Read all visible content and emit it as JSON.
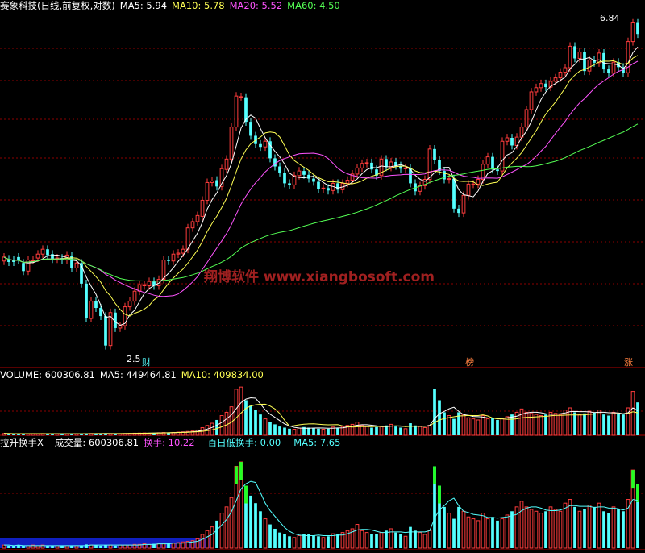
{
  "colors": {
    "up": "#ff3c3c",
    "down": "#54ffff",
    "ma5": "#ffffff",
    "ma10": "#ffff54",
    "ma20": "#ff54ff",
    "ma60": "#54ff54",
    "volume_ma10": "#ffff54",
    "cyan_text": "#54ffff",
    "watermark": "#a02020",
    "mask_blue": "#1020c0"
  },
  "main_panel": {
    "title": "赛象科技(日线,前复权,对数)",
    "ma5_label": "MA5: 5.94",
    "ma10_label": "MA10: 5.78",
    "ma20_label": "MA20: 5.52",
    "ma60_label": "MA60: 4.50",
    "high_label": "6.84",
    "low_label": "2.5",
    "marker_cai": "财",
    "marker_bang": "榜",
    "marker_zhang": "涨",
    "watermark": "翔博软件  www.xiangbosoft.com"
  },
  "volume_panel": {
    "title": "VOLUME: 600306.81",
    "ma5_label": "MA5: 449464.81",
    "ma10_label": "MA10: 409834.00"
  },
  "indicator_panel": {
    "title": "拉升换手X",
    "volume_label": "成交量: 600306.81",
    "turnover_label": "换手: 10.22",
    "low_turnover_label": "百日低换手: 0.00",
    "ma5_label": "MA5: 7.65"
  },
  "chart_data": {
    "type": "candlestick",
    "y_scale": "log",
    "price_ylim": [
      2.5,
      6.9
    ],
    "volume_ylim": [
      0,
      1000000
    ],
    "turnover_ylim": [
      0,
      16
    ],
    "min_low": 2.5,
    "max_high": 6.84,
    "bars": 132,
    "o": [
      3.32,
      3.34,
      3.33,
      3.36,
      3.3,
      3.22,
      3.33,
      3.35,
      3.39,
      3.44,
      3.39,
      3.34,
      3.35,
      3.33,
      3.37,
      3.25,
      3.3,
      3.1,
      2.79,
      2.94,
      2.88,
      2.81,
      2.57,
      2.84,
      2.71,
      2.73,
      2.89,
      2.94,
      3.03,
      3.08,
      3.08,
      3.12,
      3.08,
      3.14,
      3.33,
      3.32,
      3.39,
      3.4,
      3.44,
      3.67,
      3.74,
      3.8,
      3.99,
      4.21,
      4.24,
      4.16,
      4.38,
      4.52,
      4.98,
      5.46,
      5.45,
      5.06,
      4.85,
      4.73,
      4.69,
      4.77,
      4.53,
      4.42,
      4.34,
      4.2,
      4.18,
      4.3,
      4.36,
      4.31,
      4.26,
      4.22,
      4.13,
      4.14,
      4.11,
      4.2,
      4.12,
      4.2,
      4.24,
      4.32,
      4.4,
      4.46,
      4.47,
      4.38,
      4.3,
      4.52,
      4.41,
      4.48,
      4.43,
      4.39,
      4.4,
      4.2,
      4.1,
      4.17,
      4.25,
      4.66,
      4.51,
      4.36,
      4.25,
      4.26,
      3.89,
      3.84,
      4.05,
      4.19,
      4.19,
      4.25,
      4.45,
      4.55,
      4.38,
      4.36,
      4.77,
      4.82,
      4.71,
      4.83,
      4.98,
      5.25,
      5.54,
      5.61,
      5.68,
      5.62,
      5.72,
      5.78,
      5.88,
      5.96,
      6.36,
      6.13,
      6.25,
      5.9,
      6.1,
      6.05,
      6.23,
      5.93,
      5.86,
      6.06,
      5.97,
      5.87,
      6.45,
      6.84
    ],
    "c": [
      3.36,
      3.31,
      3.31,
      3.33,
      3.22,
      3.33,
      3.33,
      3.39,
      3.44,
      3.38,
      3.34,
      3.35,
      3.33,
      3.38,
      3.25,
      3.3,
      3.1,
      2.79,
      2.94,
      2.88,
      2.81,
      2.57,
      2.84,
      2.71,
      2.73,
      2.89,
      2.94,
      3.03,
      3.09,
      3.09,
      3.12,
      3.08,
      3.14,
      3.33,
      3.32,
      3.39,
      3.4,
      3.44,
      3.67,
      3.74,
      3.81,
      3.99,
      4.21,
      4.23,
      4.16,
      4.39,
      4.52,
      4.98,
      5.47,
      5.46,
      5.06,
      4.85,
      4.73,
      4.69,
      4.77,
      4.53,
      4.42,
      4.34,
      4.2,
      4.18,
      4.3,
      4.36,
      4.31,
      4.26,
      4.22,
      4.13,
      4.14,
      4.11,
      4.2,
      4.12,
      4.2,
      4.24,
      4.32,
      4.4,
      4.46,
      4.47,
      4.38,
      4.3,
      4.52,
      4.41,
      4.48,
      4.43,
      4.39,
      4.4,
      4.2,
      4.1,
      4.17,
      4.25,
      4.66,
      4.51,
      4.36,
      4.25,
      4.26,
      3.89,
      3.84,
      4.05,
      4.19,
      4.19,
      4.25,
      4.45,
      4.55,
      4.38,
      4.36,
      4.77,
      4.82,
      4.71,
      4.83,
      4.98,
      5.25,
      5.54,
      5.61,
      5.68,
      5.62,
      5.72,
      5.78,
      5.88,
      5.96,
      6.36,
      6.13,
      6.25,
      5.9,
      6.1,
      6.05,
      6.23,
      5.93,
      5.86,
      6.06,
      5.97,
      5.87,
      6.45,
      6.84,
      6.6
    ],
    "volume": [
      32000,
      30000,
      28000,
      30000,
      26000,
      28000,
      30000,
      29000,
      31000,
      27000,
      25000,
      28000,
      26000,
      27000,
      24000,
      26000,
      28000,
      36000,
      32000,
      30000,
      28000,
      34000,
      30000,
      28000,
      30000,
      32000,
      34000,
      38000,
      40000,
      42000,
      38000,
      44000,
      46000,
      50000,
      48000,
      52000,
      58000,
      62000,
      70000,
      78000,
      96000,
      140000,
      180000,
      220000,
      280000,
      360000,
      420000,
      520000,
      840000,
      880000,
      640000,
      540000,
      460000,
      380000,
      300000,
      240000,
      200000,
      160000,
      140000,
      120000,
      110000,
      130000,
      150000,
      140000,
      130000,
      120000,
      110000,
      120000,
      150000,
      140000,
      160000,
      180000,
      200000,
      240000,
      180000,
      160000,
      140000,
      150000,
      160000,
      180000,
      200000,
      160000,
      140000,
      120000,
      220000,
      180000,
      160000,
      140000,
      180000,
      840000,
      640000,
      420000,
      360000,
      300000,
      420000,
      380000,
      320000,
      300000,
      280000,
      360000,
      300000,
      320000,
      280000,
      300000,
      340000,
      380000,
      420000,
      480000,
      420000,
      400000,
      380000,
      360000,
      380000,
      420000,
      400000,
      380000,
      460000,
      500000,
      420000,
      380000,
      400000,
      440000,
      420000,
      460000,
      380000,
      360000,
      420000,
      400000,
      380000,
      500000,
      800000,
      600306.81
    ],
    "volume_ma5": [
      32000,
      31000,
      30000,
      30000,
      29200,
      28400,
      28400,
      28600,
      28800,
      29000,
      28400,
      28000,
      27400,
      26600,
      26000,
      26200,
      26200,
      28200,
      29200,
      30400,
      30800,
      32000,
      31200,
      30400,
      30000,
      30800,
      30800,
      32400,
      34800,
      37200,
      38400,
      39600,
      42000,
      44000,
      45200,
      48000,
      50800,
      54000,
      58000,
      64000,
      72800,
      89200,
      112800,
      142800,
      183200,
      236000,
      300000,
      372000,
      484000,
      596000,
      660000,
      684000,
      676000,
      572000,
      464000,
      384000,
      328000,
      268000,
      208000,
      172000,
      146000,
      132000,
      130000,
      130000,
      132000,
      134000,
      132000,
      128000,
      130000,
      134000,
      136000,
      150000,
      166000,
      184000,
      192000,
      192000,
      184000,
      174000,
      158000,
      158000,
      166000,
      170000,
      166000,
      160000,
      168000,
      164000,
      164000,
      164000,
      180000,
      304000,
      392000,
      436000,
      484000,
      512000,
      436000,
      376000,
      364000,
      344000,
      340000,
      332000,
      316000,
      316000,
      304000,
      312000,
      320000,
      332000,
      348000,
      384000,
      408000,
      420000,
      420000,
      412000,
      392000,
      384000,
      388000,
      392000,
      408000,
      432000,
      436000,
      432000,
      432000,
      428000,
      416000,
      420000,
      420000,
      412000,
      412000,
      408000,
      392000,
      412000,
      500000,
      449464.81
    ],
    "volume_ma10": [
      32000,
      31000,
      30000,
      30000,
      29200,
      29200,
      29400,
      29400,
      29800,
      29400,
      28700,
      28500,
      28300,
      28000,
      27700,
      27500,
      27300,
      28100,
      28200,
      28800,
      29200,
      30000,
      30000,
      30100,
      30700,
      31300,
      32100,
      33700,
      35500,
      37300,
      38300,
      39300,
      40900,
      43100,
      44900,
      47100,
      49500,
      52300,
      55700,
      59700,
      64500,
      72700,
      84900,
      100300,
      123500,
      154500,
      191500,
      236500,
      318500,
      405500,
      491500,
      535500,
      557500,
      565500,
      567500,
      534500,
      481500,
      398500,
      273500,
      165500,
      176300,
      191300,
      201300,
      207300,
      208500,
      201700,
      195700,
      191500,
      192500,
      193500,
      172500,
      158500,
      151500,
      155500,
      158500,
      159500,
      159500,
      162500,
      162500,
      164500,
      168500,
      173500,
      170500,
      158000,
      163000,
      165000,
      167000,
      166000,
      170000,
      235500,
      279500,
      305500,
      323500,
      337500,
      353500,
      357500,
      361500,
      361000,
      361000,
      373000,
      353500,
      315000,
      300000,
      300000,
      293000,
      293000,
      301000,
      317000,
      327000,
      331000,
      337000,
      341000,
      345000,
      357000,
      363000,
      364000,
      368000,
      372000,
      372000,
      370000,
      374000,
      382000,
      388000,
      392000,
      390000,
      388000,
      392000,
      393000,
      389000,
      397000,
      430000,
      409834.0
    ],
    "turnover": [
      0.5,
      0.4,
      0.4,
      0.5,
      0.4,
      0.4,
      0.5,
      0.4,
      0.5,
      0.4,
      0.4,
      0.4,
      0.4,
      0.4,
      0.4,
      0.4,
      0.4,
      0.6,
      0.5,
      0.5,
      0.4,
      0.5,
      0.5,
      0.4,
      0.5,
      0.5,
      0.5,
      0.6,
      0.6,
      0.7,
      0.6,
      0.7,
      0.7,
      0.8,
      0.8,
      0.8,
      0.9,
      1.0,
      1.1,
      1.2,
      1.5,
      2.2,
      2.8,
      3.4,
      4.4,
      5.6,
      6.6,
      8.1,
      13.1,
      13.8,
      10.0,
      8.4,
      7.2,
      5.9,
      4.7,
      3.8,
      3.1,
      2.5,
      2.2,
      1.9,
      1.7,
      2.0,
      2.3,
      2.2,
      2.0,
      1.9,
      1.7,
      1.9,
      2.3,
      2.2,
      2.5,
      2.8,
      3.1,
      3.8,
      2.8,
      2.5,
      2.2,
      2.3,
      2.5,
      2.8,
      3.1,
      2.5,
      2.2,
      1.9,
      3.4,
      2.8,
      2.5,
      2.2,
      2.8,
      13.1,
      10.0,
      6.6,
      5.6,
      4.7,
      6.6,
      5.9,
      5.0,
      4.7,
      4.4,
      5.6,
      4.7,
      5.0,
      4.4,
      4.7,
      5.3,
      5.9,
      6.6,
      7.5,
      6.6,
      6.2,
      5.9,
      5.6,
      5.9,
      6.6,
      6.2,
      5.9,
      7.2,
      7.8,
      6.6,
      5.9,
      6.2,
      6.9,
      6.6,
      7.2,
      5.9,
      5.6,
      6.6,
      6.2,
      5.9,
      7.8,
      12.5,
      10.22
    ],
    "turnover_ma5": [
      0.5,
      0.5,
      0.4,
      0.5,
      0.4,
      0.4,
      0.4,
      0.4,
      0.4,
      0.4,
      0.4,
      0.4,
      0.4,
      0.4,
      0.4,
      0.4,
      0.4,
      0.4,
      0.5,
      0.5,
      0.5,
      0.5,
      0.5,
      0.5,
      0.5,
      0.5,
      0.5,
      0.5,
      0.5,
      0.6,
      0.6,
      0.6,
      0.7,
      0.7,
      0.7,
      0.8,
      0.8,
      0.8,
      0.9,
      1.0,
      1.1,
      1.4,
      1.8,
      2.2,
      2.9,
      3.7,
      4.6,
      5.8,
      7.6,
      9.5,
      10.3,
      10.7,
      10.5,
      8.9,
      7.2,
      6.0,
      5.1,
      4.2,
      3.3,
      2.7,
      2.3,
      2.1,
      2.0,
      2.0,
      2.0,
      2.1,
      2.0,
      2.0,
      2.0,
      2.1,
      2.1,
      2.3,
      2.6,
      2.9,
      3.0,
      3.0,
      2.9,
      2.7,
      2.5,
      2.5,
      2.6,
      2.6,
      2.6,
      2.5,
      2.6,
      2.6,
      2.6,
      2.6,
      2.8,
      4.8,
      6.1,
      6.8,
      7.6,
      8.0,
      6.8,
      5.9,
      5.7,
      5.4,
      5.3,
      5.2,
      4.9,
      4.9,
      4.8,
      4.9,
      5.0,
      5.2,
      5.4,
      6.0,
      6.4,
      6.6,
      6.6,
      6.4,
      6.1,
      6.0,
      6.0,
      6.1,
      6.4,
      6.8,
      6.8,
      6.7,
      6.7,
      6.7,
      6.5,
      6.6,
      6.6,
      6.4,
      6.4,
      6.3,
      6.1,
      6.4,
      7.8,
      7.65
    ]
  }
}
